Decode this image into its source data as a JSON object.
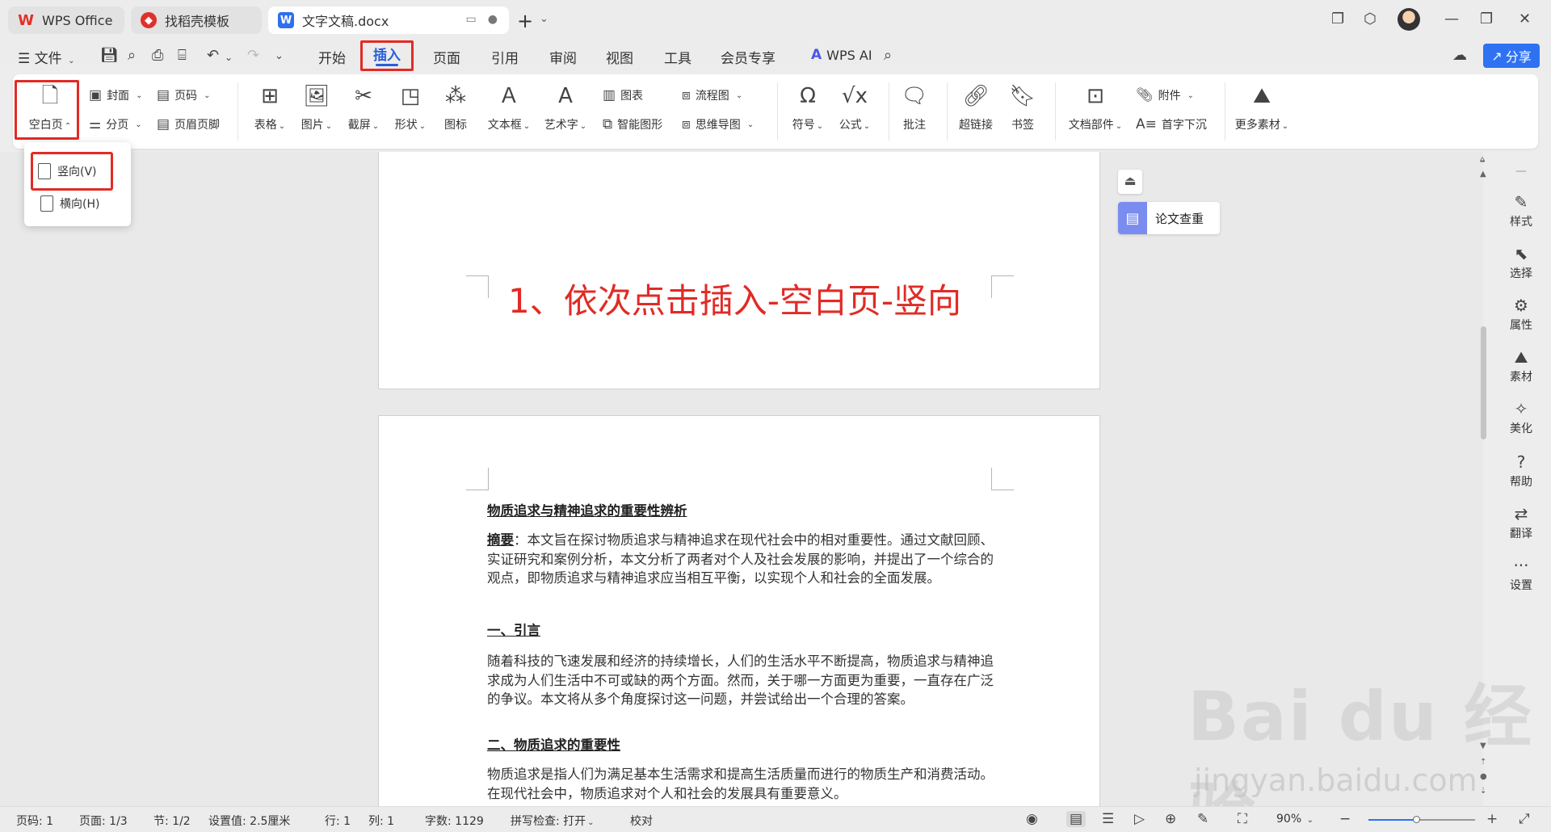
{
  "tabs": {
    "wps_office": "WPS Office",
    "template": "找稻壳模板",
    "document": "文字文稿.docx"
  },
  "menubar": {
    "file": "文件",
    "tabs": [
      "开始",
      "插入",
      "页面",
      "引用",
      "审阅",
      "视图",
      "工具",
      "会员专享"
    ],
    "wps_ai": "WPS AI",
    "share": "分享"
  },
  "ribbon": {
    "blank_page": "空白页",
    "cover": "封面",
    "page_number": "页码",
    "section": "分页",
    "header_footer": "页眉页脚",
    "table": "表格",
    "picture": "图片",
    "screenshot": "截屏",
    "shape": "形状",
    "icon": "图标",
    "textbox": "文本框",
    "wordart": "艺术字",
    "chart": "图表",
    "smartart": "智能图形",
    "flowchart": "流程图",
    "mindmap": "思维导图",
    "symbol": "符号",
    "formula": "公式",
    "comment": "批注",
    "hyperlink": "超链接",
    "bookmark": "书签",
    "doc_parts": "文档部件",
    "attachment": "附件",
    "dropcap": "首字下沉",
    "more_materials": "更多素材"
  },
  "dropdown": {
    "portrait": "竖向(V)",
    "landscape": "横向(H)"
  },
  "annotation": "1、依次点击插入-空白页-竖向",
  "document": {
    "title": "物质追求与精神追求的重要性辨析",
    "abstract_label": "摘要",
    "abstract_text": "：本文旨在探讨物质追求与精神追求在现代社会中的相对重要性。通过文献回顾、实证研究和案例分析，本文分析了两者对个人及社会发展的影响，并提出了一个综合的观点，即物质追求与精神追求应当相互平衡，以实现个人和社会的全面发展。",
    "h1": "一、引言",
    "p1": "随着科技的飞速发展和经济的持续增长，人们的生活水平不断提高，物质追求与精神追求成为人们生活中不可或缺的两个方面。然而，关于哪一方面更为重要，一直存在广泛的争议。本文将从多个角度探讨这一问题，并尝试给出一个合理的答案。",
    "h2": "二、物质追求的重要性",
    "p2": "物质追求是指人们为满足基本生活需求和提高生活质量而进行的物质生产和消费活动。在现代社会中，物质追求对个人和社会的发展具有重要意义。"
  },
  "thesis_check": "论文查重",
  "sidepanel": [
    "样式",
    "选择",
    "属性",
    "素材",
    "美化",
    "帮助",
    "翻译",
    "设置"
  ],
  "watermark": {
    "main": "Bai du 经验",
    "sub": "jingyan.baidu.com"
  },
  "statusbar": {
    "page_no": "页码: 1",
    "pages": "页面: 1/3",
    "section": "节: 1/2",
    "setting": "设置值: 2.5厘米",
    "row": "行: 1",
    "col": "列: 1",
    "words": "字数: 1129",
    "spell": "拼写检查: 打开",
    "proof": "校对",
    "zoom": "90%",
    "zoom_level": 0.45
  },
  "colors": {
    "accent": "#2e72f3",
    "highlight": "#e32a25",
    "annotation": "#e02b26"
  }
}
